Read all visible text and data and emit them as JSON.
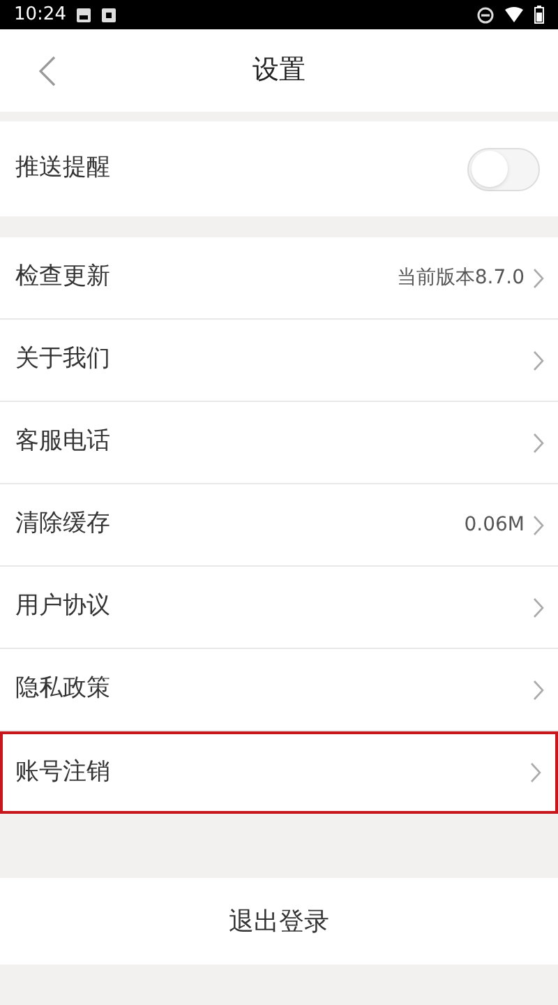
{
  "status_bar": {
    "time": "10:24"
  },
  "header": {
    "title": "设置"
  },
  "push": {
    "label": "推送提醒",
    "on": false
  },
  "items": [
    {
      "label": "检查更新",
      "value": "当前版本8.7.0",
      "highlighted": false
    },
    {
      "label": "关于我们",
      "highlighted": false
    },
    {
      "label": "客服电话",
      "highlighted": false
    },
    {
      "label": "清除缓存",
      "value": "0.06M",
      "highlighted": false
    },
    {
      "label": "用户协议",
      "highlighted": false
    },
    {
      "label": "隐私政策",
      "highlighted": false
    },
    {
      "label": "账号注销",
      "highlighted": true
    }
  ],
  "logout": {
    "label": "退出登录"
  }
}
